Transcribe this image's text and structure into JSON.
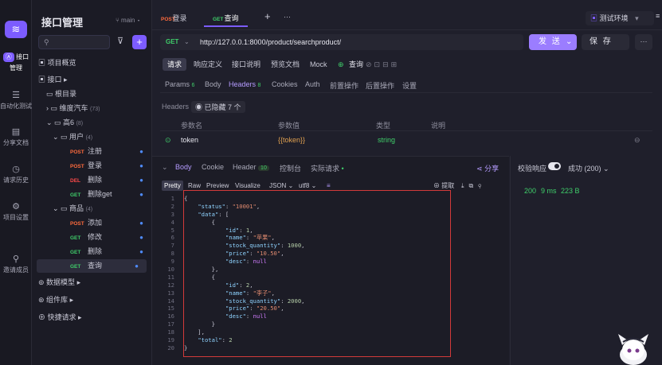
{
  "rail": {
    "items": [
      {
        "label": "接口管理",
        "icon": "api-icon"
      },
      {
        "label": "自动化测试",
        "icon": "automation-icon"
      },
      {
        "label": "分享文档",
        "icon": "doc-icon"
      },
      {
        "label": "请求历史",
        "icon": "history-icon"
      },
      {
        "label": "项目设置",
        "icon": "settings-icon"
      },
      {
        "label": "邀请成员",
        "icon": "invite-icon"
      }
    ]
  },
  "sidebar": {
    "title": "接口管理",
    "branch": "main",
    "overview": "项目概览",
    "interface": "接口",
    "root": "根目录",
    "groups": [
      {
        "name": "维度汽车",
        "count": "(73)"
      },
      {
        "name": "高6",
        "count": "(8)"
      },
      {
        "name": "用户",
        "count": "(4)"
      },
      {
        "name": "商品",
        "count": "(4)"
      }
    ],
    "user_apis": [
      {
        "method": "POST",
        "name": "注册"
      },
      {
        "method": "POST",
        "name": "登录"
      },
      {
        "method": "DEL",
        "name": "删除"
      },
      {
        "method": "GET",
        "name": "删除get"
      }
    ],
    "product_apis": [
      {
        "method": "POST",
        "name": "添加"
      },
      {
        "method": "GET",
        "name": "修改"
      },
      {
        "method": "GET",
        "name": "删除"
      },
      {
        "method": "GET",
        "name": "查询"
      }
    ],
    "data_model": "数据模型",
    "components": "组件库",
    "quick_request": "快捷请求"
  },
  "tabs": [
    {
      "method": "POST",
      "name": "登录"
    },
    {
      "method": "GET",
      "name": "查询"
    }
  ],
  "env": "测试环境",
  "request": {
    "method": "GET",
    "url": "http://127.0.0.1:8000/product/searchproduct/",
    "send_label": "发 送",
    "save_label": "保 存"
  },
  "segments": [
    "请求",
    "响应定义",
    "接口说明",
    "预览文档",
    "Mock"
  ],
  "api_name": "查询",
  "param_tabs": [
    {
      "label": "Params",
      "badge": "6"
    },
    {
      "label": "Body",
      "badge": ""
    },
    {
      "label": "Headers",
      "badge": "8"
    },
    {
      "label": "Cookies",
      "badge": ""
    },
    {
      "label": "Auth",
      "badge": ""
    },
    {
      "label": "前置操作",
      "badge": ""
    },
    {
      "label": "后置操作",
      "badge": ""
    },
    {
      "label": "设置",
      "badge": ""
    }
  ],
  "headers": {
    "label": "Headers",
    "hidden": "已隐藏 7 个",
    "columns": [
      "参数名",
      "参数值",
      "类型",
      "说明"
    ],
    "row": {
      "name": "token",
      "value": "{{token}}",
      "type": "string"
    }
  },
  "response": {
    "tabs": [
      {
        "label": "Body",
        "badge": ""
      },
      {
        "label": "Cookie",
        "badge": ""
      },
      {
        "label": "Header",
        "badge": "10"
      },
      {
        "label": "控制台",
        "badge": ""
      },
      {
        "label": "实际请求",
        "badge": ""
      }
    ],
    "share": "分享",
    "formats": [
      "Pretty",
      "Raw",
      "Preview",
      "Visualize"
    ],
    "lang": "JSON",
    "encoding": "utf8",
    "extract": "提取",
    "code": [
      "{",
      "    \"status\": \"10001\",",
      "    \"data\": [",
      "        {",
      "            \"id\": 1,",
      "            \"name\": \"苹果\",",
      "            \"stock_quantity\": 1000,",
      "            \"price\": \"10.50\",",
      "            \"desc\": null",
      "        },",
      "        {",
      "            \"id\": 2,",
      "            \"name\": \"李子\",",
      "            \"stock_quantity\": 2000,",
      "            \"price\": \"20.50\",",
      "            \"desc\": null",
      "        }",
      "    ],",
      "    \"total\": 2",
      "}"
    ]
  },
  "validation": {
    "label": "校验响应",
    "result": "成功 (200)",
    "status": "200",
    "time": "9 ms",
    "size": "223 B"
  }
}
